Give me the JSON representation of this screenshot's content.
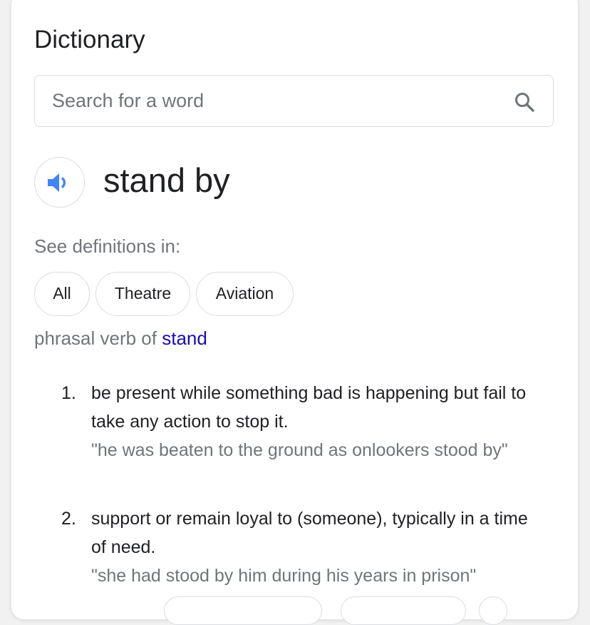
{
  "header": {
    "title": "Dictionary"
  },
  "search": {
    "placeholder": "Search for a word",
    "value": ""
  },
  "entry": {
    "headword": "stand by",
    "speaker_icon": "volume-up-icon"
  },
  "see_definitions": {
    "label": "See definitions in:",
    "chips": [
      {
        "label": "All"
      },
      {
        "label": "Theatre"
      },
      {
        "label": "Aviation"
      }
    ]
  },
  "part_of_speech": {
    "prefix": "phrasal verb of ",
    "link_text": "stand"
  },
  "definitions": [
    {
      "number": "1.",
      "definition": "be present while something bad is happening but fail to take any action to stop it.",
      "example": "\"he was beaten to the ground as onlookers stood by\""
    },
    {
      "number": "2.",
      "definition": "support or remain loyal to (someone), typically in a time of need.",
      "example": "\"she had stood by him during his years in prison\""
    }
  ],
  "colors": {
    "link": "#1a0dab",
    "speaker_blue": "#4285f4",
    "secondary_text": "#70757a",
    "primary_text": "#202124",
    "border": "#dadce0"
  }
}
